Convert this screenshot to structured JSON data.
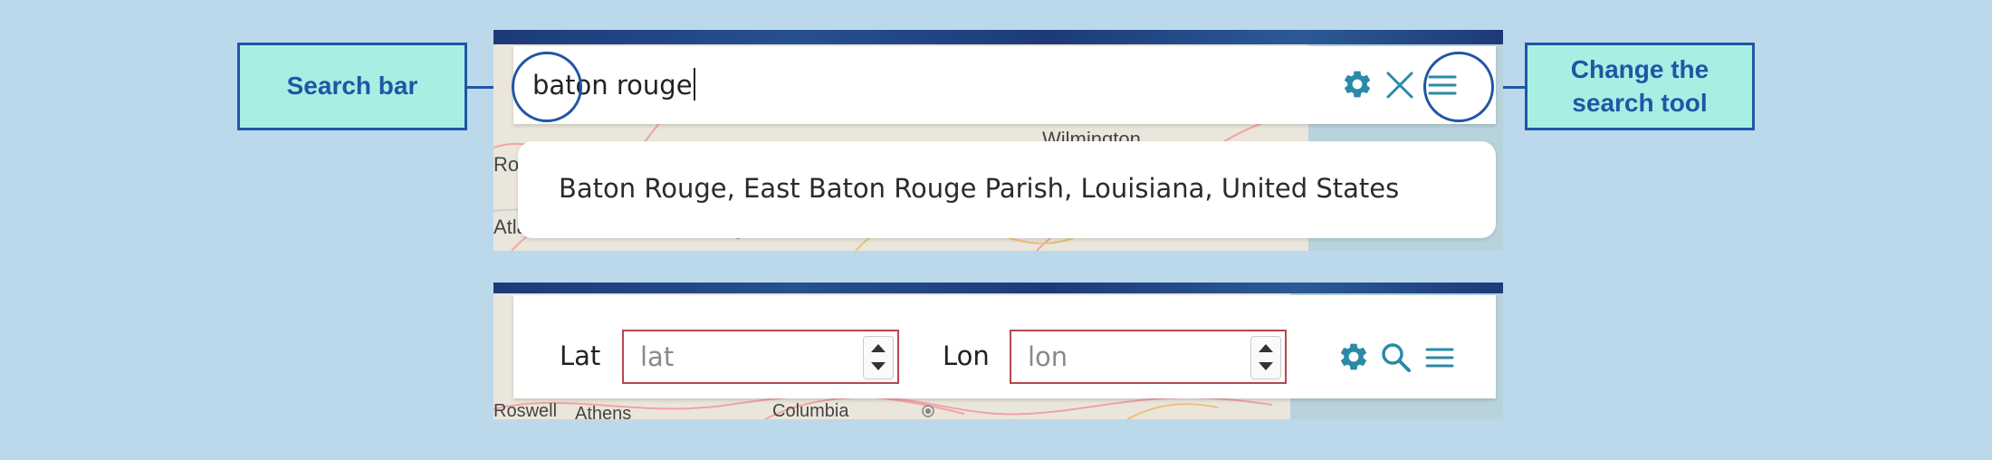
{
  "callouts": {
    "search_bar": "Search bar",
    "change_tool_line1": "Change the",
    "change_tool_line2": "search tool"
  },
  "search_panel": {
    "query": "baton rouge",
    "result": "Baton Rouge, East Baton Rouge Parish, Louisiana, United States",
    "map_labels": [
      "Ros",
      "Atla",
      "Wilmington"
    ]
  },
  "coordinate_panel": {
    "lat_label": "Lat",
    "lat_placeholder": "lat",
    "lon_label": "Lon",
    "lon_placeholder": "lon",
    "map_labels": [
      "Roswell",
      "Athens",
      "Columbia"
    ]
  },
  "icons": {
    "settings": "gear-icon",
    "clear": "close-icon",
    "search": "search-icon",
    "menu": "hamburger-menu-icon"
  },
  "colors": {
    "icon_teal": "#2a8aa8",
    "callout_fill": "#a7efe3",
    "callout_border": "#1f56a5",
    "field_border": "#b5474e",
    "background": "#bcd9ec"
  }
}
